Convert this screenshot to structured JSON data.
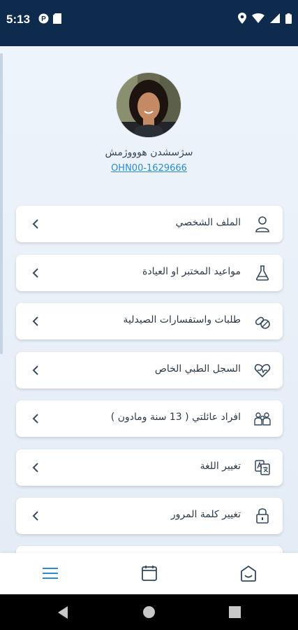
{
  "status_bar": {
    "time": "5:13",
    "icons": [
      "notification-p-icon",
      "sd-card-icon",
      "location-icon",
      "wifi-icon",
      "signal-icon",
      "battery-icon"
    ]
  },
  "profile": {
    "name": "سژسشدن هوووژمش",
    "id": "OHN00-1629666"
  },
  "menu": [
    {
      "label": "الملف الشخصي",
      "icon": "person-icon"
    },
    {
      "label": "مواعيد المختبر او العيادة",
      "icon": "flask-icon"
    },
    {
      "label": "طلبات واستفسارات الصيدلية",
      "icon": "pills-icon"
    },
    {
      "label": "السجل الطبي الخاص",
      "icon": "heart-pulse-icon"
    },
    {
      "label": "افراد عائلتي ( 13 سنة ومادون )",
      "icon": "family-icon"
    },
    {
      "label": "تغيير اللغة",
      "icon": "translate-icon"
    },
    {
      "label": "تغيير كلمة المرور",
      "icon": "lock-icon"
    }
  ],
  "bottom_nav": [
    {
      "name": "menu",
      "icon": "hamburger-menu-icon",
      "active": true
    },
    {
      "name": "calendar",
      "icon": "calendar-icon",
      "active": false
    },
    {
      "name": "home",
      "icon": "home-icon",
      "active": false
    }
  ],
  "colors": {
    "header": "#0e2a4d",
    "accent": "#2b8cd6",
    "background": "#e9f1f9",
    "icon": "#34495e"
  }
}
